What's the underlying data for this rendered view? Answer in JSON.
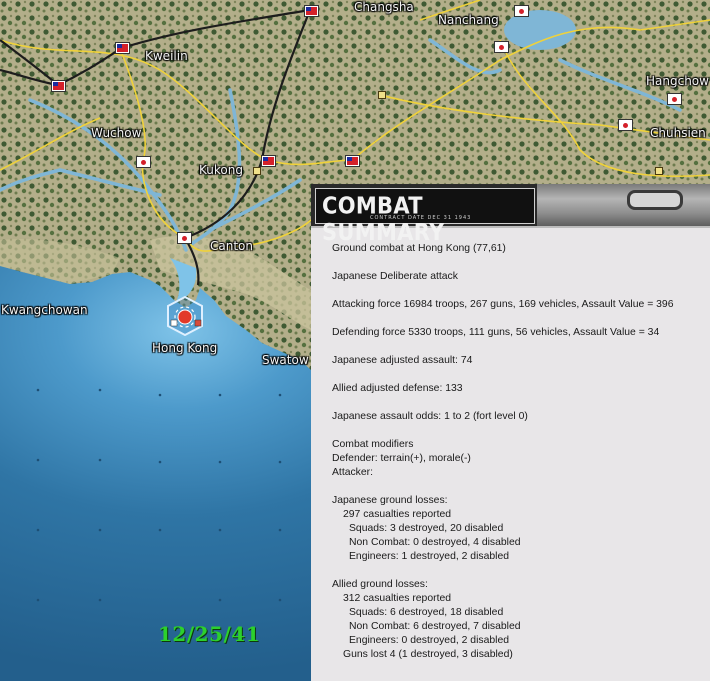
{
  "map": {
    "towns": [
      {
        "id": "changsha",
        "label": "Changsha"
      },
      {
        "id": "nanchang",
        "label": "Nanchang"
      },
      {
        "id": "kweilin",
        "label": "Kweilin"
      },
      {
        "id": "hangchow",
        "label": "Hangchow"
      },
      {
        "id": "wuchow",
        "label": "Wuchow"
      },
      {
        "id": "chuhsien",
        "label": "Chuhsien"
      },
      {
        "id": "kukong",
        "label": "Kukong"
      },
      {
        "id": "canton",
        "label": "Canton"
      },
      {
        "id": "kwangchowan",
        "label": "Kwangchowan"
      },
      {
        "id": "hongkong",
        "label": "Hong Kong"
      },
      {
        "id": "swatow",
        "label": "Swatow"
      }
    ],
    "date": "12/25/41",
    "colors": {
      "chinese_flag": "#d4202a",
      "japanese_flag": "#ffffff",
      "date_text": "#2cd12c",
      "sea": "#2f75a5",
      "land": "#b3ae8a"
    }
  },
  "panel": {
    "title": "COMBAT SUMMARY",
    "subtitle": "CONTRACT DATE DEC 31 1943",
    "lines": {
      "l1": "Ground combat at Hong Kong (77,61)",
      "l2": "Japanese Deliberate attack",
      "l3": "Attacking force 16984 troops, 267 guns, 169 vehicles, Assault Value = 396",
      "l4": "Defending force 5330 troops, 111 guns, 56 vehicles, Assault Value = 34",
      "l5": "Japanese adjusted assault: 74",
      "l6": "Allied adjusted defense: 133",
      "l7": "Japanese assault odds: 1 to 2 (fort level 0)",
      "l8": "Combat modifiers",
      "l9": "Defender: terrain(+), morale(-)",
      "l10": "Attacker:",
      "l11": "Japanese ground losses:",
      "l12": "297 casualties reported",
      "l13": "Squads: 3 destroyed, 20 disabled",
      "l14": "Non Combat: 0 destroyed, 4 disabled",
      "l15": "Engineers: 1 destroyed, 2 disabled",
      "l16": "Allied ground losses:",
      "l17": "312 casualties reported",
      "l18": "Squads: 6 destroyed, 18 disabled",
      "l19": "Non Combat: 6 destroyed, 7 disabled",
      "l20": "Engineers: 0 destroyed, 2 disabled",
      "l21": "Guns lost 4 (1 destroyed, 3 disabled)"
    }
  }
}
